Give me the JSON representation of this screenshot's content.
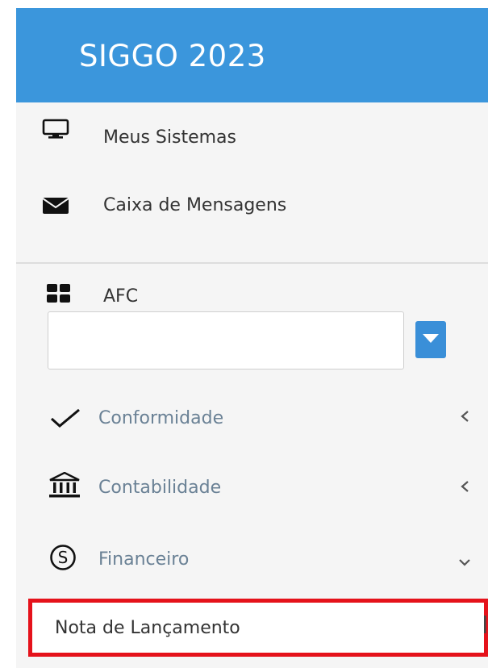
{
  "header": {
    "title": "SIGGO 2023"
  },
  "nav": {
    "items": [
      {
        "label": "Meus Sistemas",
        "icon": "monitor-icon"
      },
      {
        "label": "Caixa de Mensagens",
        "icon": "envelope-icon"
      }
    ]
  },
  "afc": {
    "label": "AFC",
    "icon": "grid-icon",
    "select_value": ""
  },
  "menu": {
    "items": [
      {
        "label": "Conformidade",
        "icon": "check-icon",
        "chevron": "chevron-left-icon"
      },
      {
        "label": "Contabilidade",
        "icon": "bank-icon",
        "chevron": "chevron-left-icon"
      },
      {
        "label": "Financeiro",
        "icon": "dollar-circle-icon",
        "chevron": "chevron-down-icon"
      }
    ],
    "submenu": {
      "label": "Nota de Lançamento"
    }
  },
  "colors": {
    "header_bg": "#3b96dc",
    "sidebar_bg": "#f5f5f5",
    "highlight_border": "#e5121b",
    "menu_text": "#6a8195"
  }
}
